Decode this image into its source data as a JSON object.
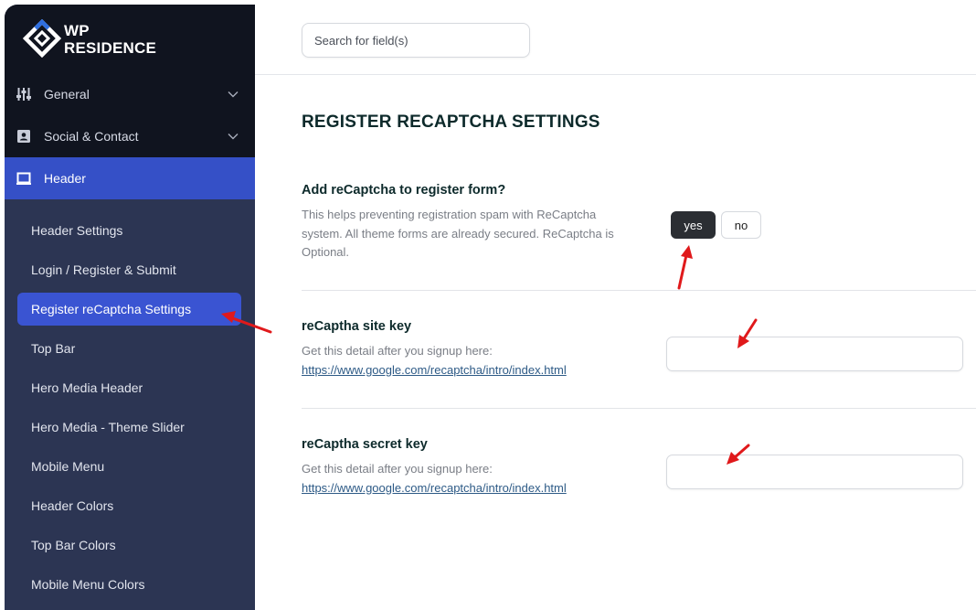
{
  "brand": {
    "line1": "WP",
    "line2": "RESIDENCE"
  },
  "sidebar": {
    "top_items": [
      {
        "label": "General",
        "icon": "sliders-icon",
        "expandable": true
      },
      {
        "label": "Social & Contact",
        "icon": "contact-card-icon",
        "expandable": true
      },
      {
        "label": "Header",
        "icon": "monitor-icon",
        "active": true
      }
    ],
    "sub_items": [
      {
        "label": "Header Settings"
      },
      {
        "label": "Login / Register & Submit"
      },
      {
        "label": "Register reCaptcha Settings",
        "active": true
      },
      {
        "label": "Top Bar"
      },
      {
        "label": "Hero Media Header"
      },
      {
        "label": "Hero Media - Theme Slider"
      },
      {
        "label": "Mobile Menu"
      },
      {
        "label": "Header Colors"
      },
      {
        "label": "Top Bar Colors"
      },
      {
        "label": "Mobile Menu Colors"
      }
    ]
  },
  "search": {
    "placeholder": "Search for field(s)"
  },
  "main": {
    "section_title": "REGISTER RECAPTCHA SETTINGS",
    "options": [
      {
        "title": "Add reCaptcha to register form?",
        "description": "This helps preventing registration spam with ReCaptcha system. All theme forms are already secured. ReCaptcha is Optional.",
        "toggle": {
          "yes": "yes",
          "no": "no",
          "selected": "yes"
        }
      },
      {
        "title": "reCaptha site key",
        "description": "Get this detail after you signup here:",
        "link": "https://www.google.com/recaptcha/intro/index.html",
        "value": ""
      },
      {
        "title": "reCaptha secret key",
        "description": "Get this detail after you signup here:",
        "link": "https://www.google.com/recaptcha/intro/index.html",
        "value": ""
      }
    ]
  },
  "colors": {
    "sidebar_bg": "#2c3553",
    "sidebar_dark": "#10141f",
    "active_blue": "#3550c7",
    "annotation_red": "#e0191b",
    "logo_accent": "#2f6fe0"
  }
}
